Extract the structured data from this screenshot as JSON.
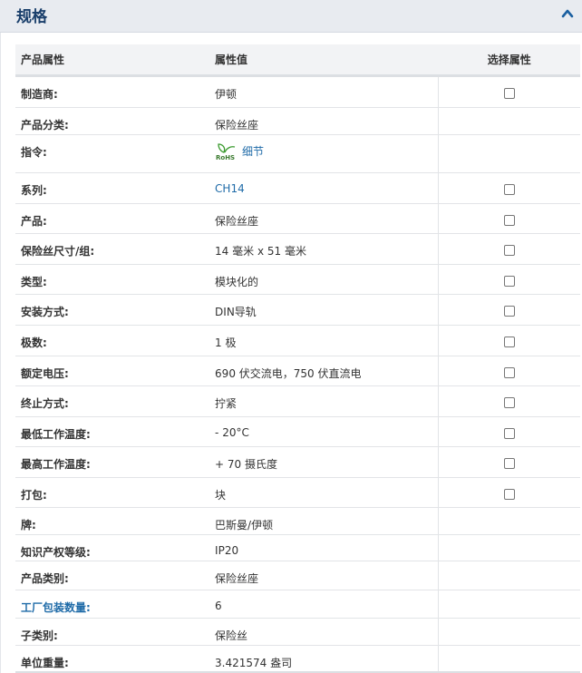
{
  "header": {
    "title": "规格"
  },
  "table": {
    "columns": {
      "attr": "产品属性",
      "value": "属性值",
      "select": "选择属性"
    },
    "rows": [
      {
        "attr": "制造商:",
        "value": "伊顿",
        "checkbox": true,
        "h": 35
      },
      {
        "attr": "产品分类:",
        "value": "保险丝座",
        "checkbox": false,
        "h": 30
      },
      {
        "attr": "指令:",
        "value": "",
        "rohs": true,
        "rohs_link": "细节",
        "checkbox": false,
        "h": 42
      },
      {
        "attr": "系列:",
        "value": "CH14",
        "value_link": true,
        "checkbox": true,
        "h": 34
      },
      {
        "attr": "产品:",
        "value": "保险丝座",
        "checkbox": true,
        "h": 33
      },
      {
        "attr": "保险丝尺寸/组:",
        "value": "14 毫米 x 51 毫米",
        "checkbox": true,
        "h": 34
      },
      {
        "attr": "类型:",
        "value": "模块化的",
        "checkbox": true,
        "h": 33
      },
      {
        "attr": "安装方式:",
        "value": "DIN导轨",
        "checkbox": true,
        "h": 34
      },
      {
        "attr": "极数:",
        "value": "1 极",
        "checkbox": true,
        "h": 34
      },
      {
        "attr": "额定电压:",
        "value": "690 伏交流电，750 伏直流电",
        "checkbox": true,
        "h": 33
      },
      {
        "attr": "终止方式:",
        "value": "拧紧",
        "checkbox": true,
        "h": 34
      },
      {
        "attr": "最低工作温度:",
        "value": "- 20°C",
        "checkbox": true,
        "h": 33
      },
      {
        "attr": "最高工作温度:",
        "value": "+ 70 摄氏度",
        "checkbox": true,
        "h": 34
      },
      {
        "attr": "打包:",
        "value": "块",
        "checkbox": true,
        "h": 33
      },
      {
        "attr": "牌:",
        "value": "巴斯曼/伊顿",
        "checkbox": false,
        "h": 30
      },
      {
        "attr": "知识产权等级:",
        "value": "IP20",
        "checkbox": false,
        "h": 29
      },
      {
        "attr": "产品类别:",
        "value": "保险丝座",
        "checkbox": false,
        "h": 32
      },
      {
        "attr": "工厂包装数量:",
        "value": "6",
        "attr_link": true,
        "checkbox": false,
        "h": 31
      },
      {
        "attr": "子类别:",
        "value": "保险丝",
        "checkbox": false,
        "h": 30
      },
      {
        "attr": "单位重量:",
        "value": "3.421574 盎司",
        "checkbox": false,
        "h": 29
      }
    ]
  },
  "icons": {
    "collapse": "chevron-up-icon",
    "rohs": "rohs-leaf-icon"
  },
  "colors": {
    "link": "#1f6ba8",
    "title": "#1a3f6b",
    "header_bg": "#e8ebf0"
  }
}
